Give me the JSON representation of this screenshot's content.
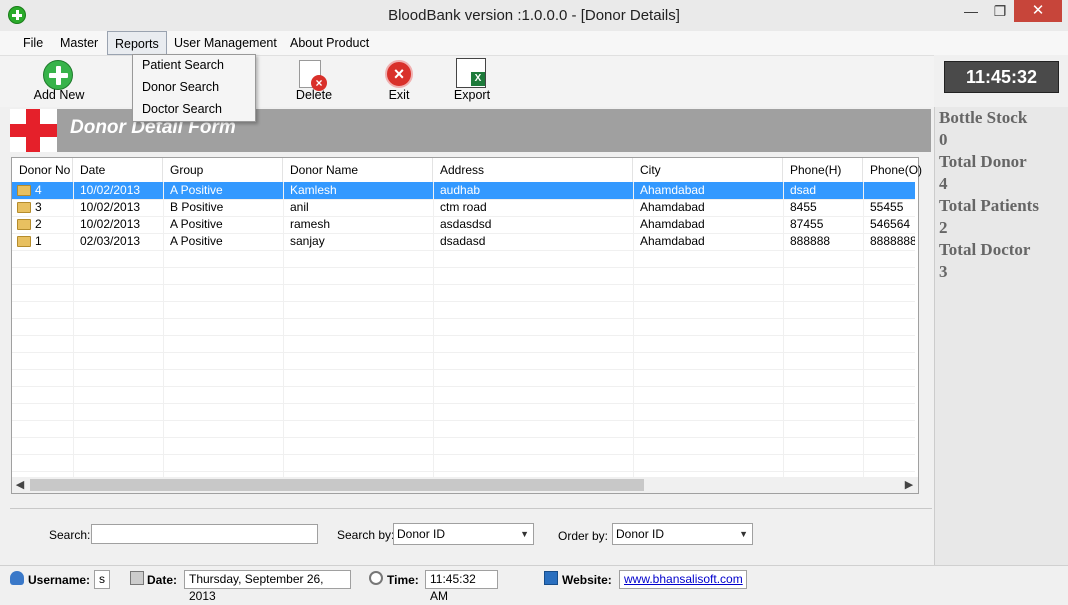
{
  "window": {
    "title": "BloodBank version :1.0.0.0 - [Donor Details]",
    "minimize": "—",
    "maximize": "❐",
    "close": "✕"
  },
  "menu": [
    "File",
    "Master",
    "Reports",
    "User Management",
    "About Product"
  ],
  "reports_menu": [
    "Patient Search",
    "Donor Search",
    "Doctor Search"
  ],
  "toolbar": {
    "add_new": "Add New",
    "delete": "Delete",
    "exit": "Exit",
    "export": "Export"
  },
  "clock": "11:45:32",
  "form_title": "Donor Detail Form",
  "stats": [
    {
      "label": "Bottle Stock",
      "value": "0"
    },
    {
      "label": "Total Donor",
      "value": "4"
    },
    {
      "label": "Total Patients",
      "value": "2"
    },
    {
      "label": "Total Doctor",
      "value": "3"
    }
  ],
  "table": {
    "columns": [
      "Donor No",
      "Date",
      "Group",
      "Donor Name",
      "Address",
      "City",
      "Phone(H)",
      "Phone(O)"
    ],
    "rows": [
      [
        "4",
        "10/02/2013",
        "A Positive",
        "Kamlesh",
        "audhab",
        "Ahamdabad",
        "dsad",
        ""
      ],
      [
        "3",
        "10/02/2013",
        "B Positive",
        "anil",
        "ctm road",
        "Ahamdabad",
        "8455",
        "55455"
      ],
      [
        "2",
        "10/02/2013",
        "A Positive",
        "ramesh",
        "asdasdsd",
        "Ahamdabad",
        "87455",
        "546564"
      ],
      [
        "1",
        "02/03/2013",
        "A Positive",
        "sanjay",
        "dsadasd",
        "Ahamdabad",
        "888888",
        "8888888"
      ]
    ],
    "selected_row": 0
  },
  "search": {
    "search_label": "Search:",
    "search_value": "",
    "search_by_label": "Search by:",
    "search_by_value": "Donor ID",
    "order_by_label": "Order by:",
    "order_by_value": "Donor ID"
  },
  "status": {
    "username_label": "Username:",
    "username_value": "s",
    "date_label": "Date:",
    "date_value": "Thursday, September 26, 2013",
    "time_label": "Time:",
    "time_value": "11:45:32 AM",
    "website_label": "Website:",
    "website_value": "www.bhansalisoft.com"
  }
}
